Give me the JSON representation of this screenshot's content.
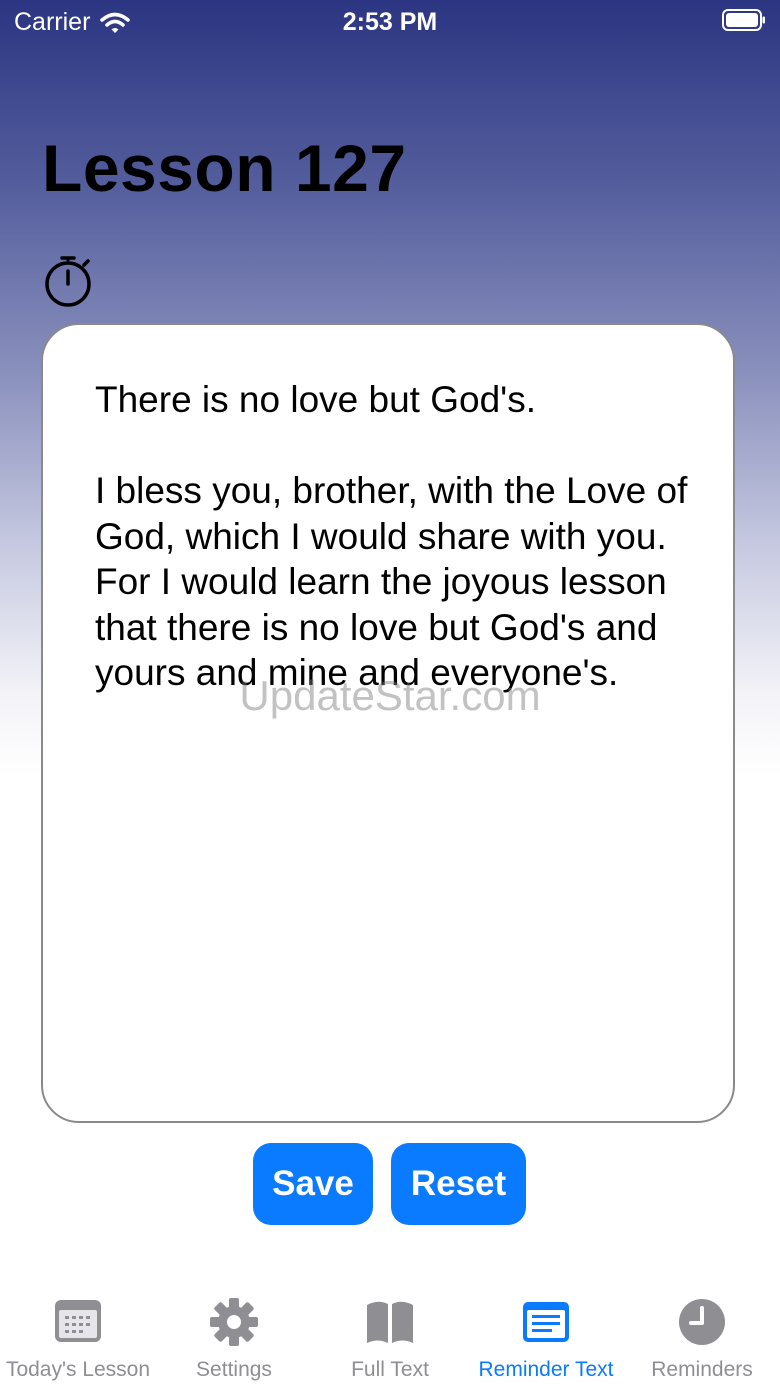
{
  "status_bar": {
    "carrier": "Carrier",
    "time": "2:53 PM"
  },
  "lesson": {
    "title": "Lesson 127"
  },
  "reminder": {
    "text": "There is no love but God's.\n\nI bless you, brother, with the Love of God, which I would share with you. For I would learn the joyous lesson that there is no love but God's and yours and mine and everyone's."
  },
  "watermark": "UpdateStar.com",
  "actions": {
    "save_label": "Save",
    "reset_label": "Reset"
  },
  "tabs": [
    {
      "label": "Today's Lesson",
      "icon": "calendar-icon",
      "active": false
    },
    {
      "label": "Settings",
      "icon": "gear-icon",
      "active": false
    },
    {
      "label": "Full Text",
      "icon": "book-icon",
      "active": false
    },
    {
      "label": "Reminder Text",
      "icon": "document-icon",
      "active": true
    },
    {
      "label": "Reminders",
      "icon": "clock-icon",
      "active": false
    }
  ],
  "colors": {
    "accent": "#0a7aff",
    "inactive": "#8e8e93",
    "header_top": "#2b3581"
  }
}
